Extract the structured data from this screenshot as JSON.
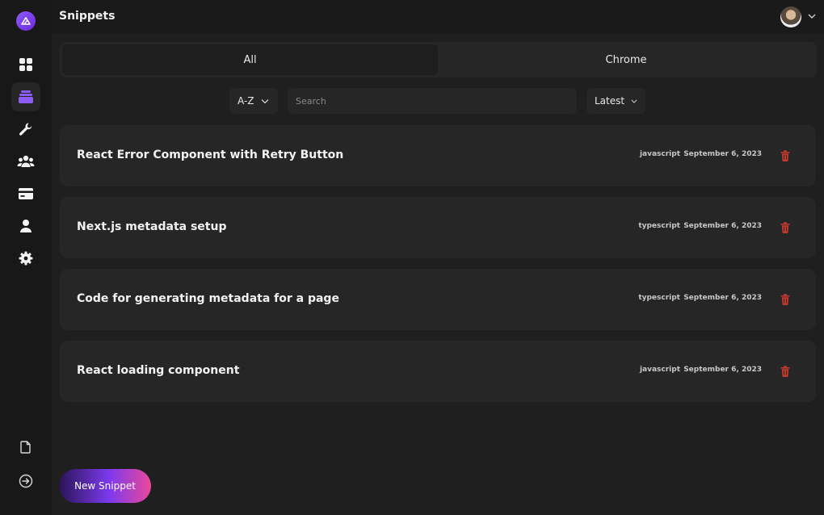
{
  "header": {
    "title": "Snippets"
  },
  "tabs": [
    {
      "label": "All",
      "active": true
    },
    {
      "label": "Chrome",
      "active": false
    }
  ],
  "controls": {
    "sort_label": "A-Z",
    "search_placeholder": "Search",
    "order_label": "Latest"
  },
  "snippets": [
    {
      "title": "React Error Component with Retry Button",
      "language": "javascript",
      "date": "September 6, 2023"
    },
    {
      "title": "Next.js metadata setup",
      "language": "typescript",
      "date": "September 6, 2023"
    },
    {
      "title": "Code for generating metadata for a page",
      "language": "typescript",
      "date": "September 6, 2023"
    },
    {
      "title": "React loading component",
      "language": "javascript",
      "date": "September 6, 2023"
    }
  ],
  "new_snippet_label": "New Snippet",
  "sidebar": {
    "items": [
      {
        "icon": "dashboard-grid-icon",
        "active": false
      },
      {
        "icon": "snippets-stack-icon",
        "active": true
      },
      {
        "icon": "wrench-icon",
        "active": false
      },
      {
        "icon": "users-icon",
        "active": false
      },
      {
        "icon": "credit-card-icon",
        "active": false
      },
      {
        "icon": "user-icon",
        "active": false
      },
      {
        "icon": "gear-icon",
        "active": false
      }
    ],
    "bottom": [
      "document-icon",
      "logout-icon"
    ]
  },
  "colors": {
    "accent": "#8b5cf6",
    "delete": "#c0392b",
    "background": "#1f1f1f",
    "card": "#262626"
  }
}
